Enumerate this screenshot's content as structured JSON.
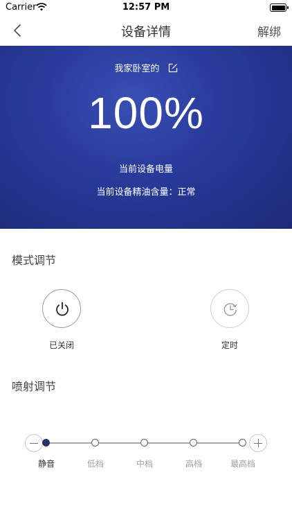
{
  "status_bar": {
    "carrier": "Carrier",
    "time": "12:57 PM"
  },
  "nav": {
    "title": "设备详情",
    "action": "解绑"
  },
  "hero": {
    "device_name": "我家卧室的",
    "battery_percent": "100%",
    "battery_label": "当前设备电量",
    "oil_status": "当前设备精油含量：正常"
  },
  "mode_section": {
    "title": "模式调节",
    "power_label": "已关闭",
    "timer_label": "定时"
  },
  "spray_section": {
    "title": "喷射调节",
    "levels": [
      "静音",
      "低档",
      "中档",
      "高档",
      "最高档"
    ],
    "selected_index": 0
  },
  "colors": {
    "hero_bg": "#283b9c",
    "active_dot": "#2a3163"
  }
}
